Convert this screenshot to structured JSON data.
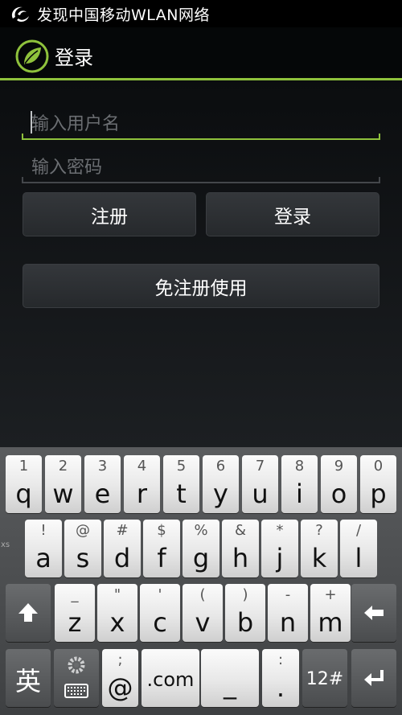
{
  "status_bar": {
    "notification_text": "发现中国移动WLAN网络"
  },
  "action_bar": {
    "title": "登录"
  },
  "form": {
    "username_placeholder": "输入用户名",
    "password_placeholder": "输入密码",
    "register_button": "注册",
    "login_button": "登录",
    "skip_register_button": "免注册使用"
  },
  "keyboard": {
    "row1": [
      {
        "hint": "1",
        "main": "q"
      },
      {
        "hint": "2",
        "main": "w"
      },
      {
        "hint": "3",
        "main": "e"
      },
      {
        "hint": "4",
        "main": "r"
      },
      {
        "hint": "5",
        "main": "t"
      },
      {
        "hint": "6",
        "main": "y"
      },
      {
        "hint": "7",
        "main": "u"
      },
      {
        "hint": "8",
        "main": "i"
      },
      {
        "hint": "9",
        "main": "o"
      },
      {
        "hint": "0",
        "main": "p"
      }
    ],
    "row2": [
      {
        "hint": "!",
        "main": "a"
      },
      {
        "hint": "@",
        "main": "s"
      },
      {
        "hint": "#",
        "main": "d"
      },
      {
        "hint": "$",
        "main": "f"
      },
      {
        "hint": "%",
        "main": "g"
      },
      {
        "hint": "&",
        "main": "h"
      },
      {
        "hint": "*",
        "main": "j"
      },
      {
        "hint": "?",
        "main": "k"
      },
      {
        "hint": "/",
        "main": "l"
      }
    ],
    "row3": [
      {
        "hint": "_",
        "main": "z"
      },
      {
        "hint": "\"",
        "main": "x"
      },
      {
        "hint": "'",
        "main": "c"
      },
      {
        "hint": "(",
        "main": "v"
      },
      {
        "hint": ")",
        "main": "b"
      },
      {
        "hint": "-",
        "main": "n"
      },
      {
        "hint": "+",
        "main": "m"
      }
    ],
    "row4": {
      "lang": "英",
      "at_hint": ";",
      "at_main": "@",
      "dotcom": ".com",
      "space": "_",
      "period_hint": ":",
      "period_main": ".",
      "symbols": "12#"
    },
    "side_mark": "xs"
  },
  "colors": {
    "accent": "#8fc23c"
  }
}
